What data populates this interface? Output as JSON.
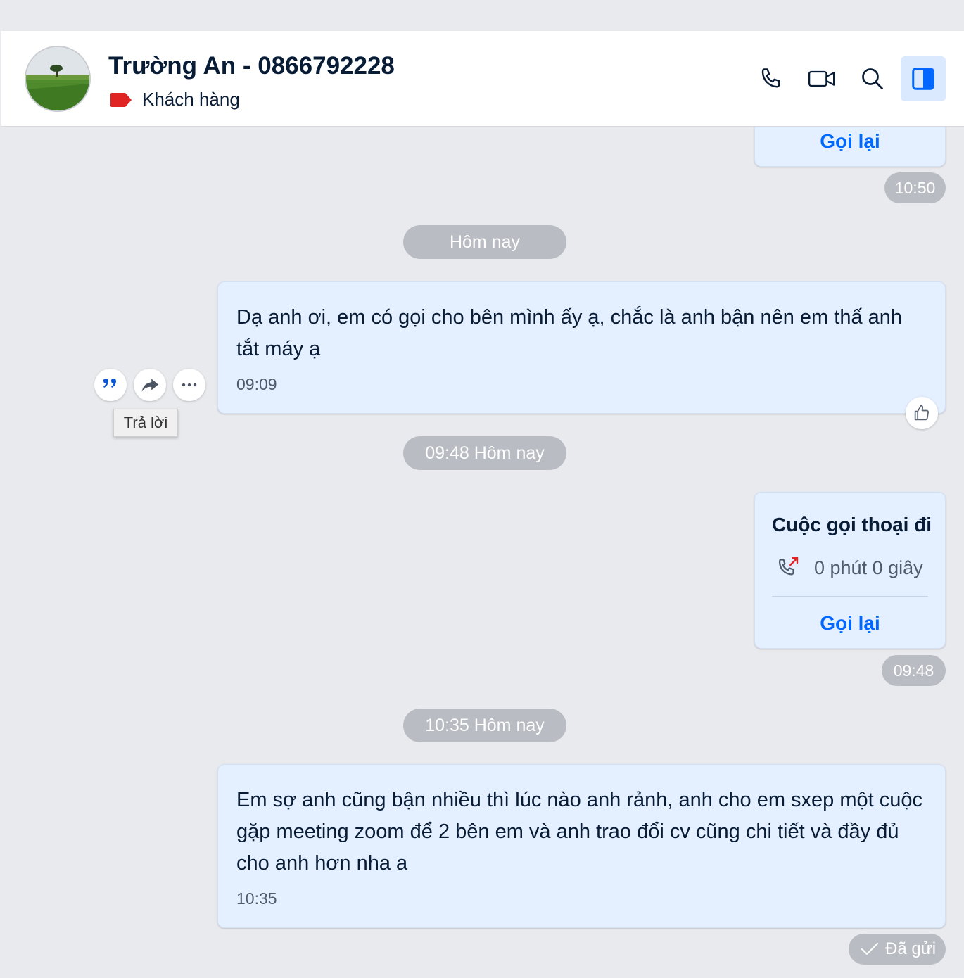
{
  "header": {
    "contact_name": "Trường An - 0866792228",
    "tag_label": "Khách hàng",
    "tag_color": "#e02424"
  },
  "icons": {
    "call": "phone-icon",
    "video": "video-icon",
    "search": "search-icon",
    "panel": "sidebar-panel-icon"
  },
  "messages": {
    "prev_call_recall": "Gọi lại",
    "prev_call_time": "10:50",
    "divider_today": "Hôm nay",
    "msg1_text": "Dạ anh ơi, em có gọi cho bên mình ấy ạ, chắc là anh bận nên em thấ anh tắt máy ạ",
    "msg1_time": "09:09",
    "divider_0948": "09:48 Hôm nay",
    "call_title": "Cuộc gọi thoại đi",
    "call_duration": "0 phút 0 giây",
    "call_recall": "Gọi lại",
    "call_time": "09:48",
    "divider_1035": "10:35 Hôm nay",
    "msg2_text": "Em sợ anh cũng bận nhiều thì lúc nào anh rảnh, anh cho em sxep một cuộc gặp meeting zoom để 2 bên em và anh trao đổi cv cũng chi tiết và đầy đủ cho anh hơn nha a",
    "msg2_time": "10:35",
    "sent_status": "Đã gửi"
  },
  "hover_actions": {
    "tooltip": "Trả lời"
  },
  "colors": {
    "accent": "#0068ff",
    "bubble": "#e4efff",
    "background": "#e8eaee",
    "pill": "#b9bcc2"
  }
}
